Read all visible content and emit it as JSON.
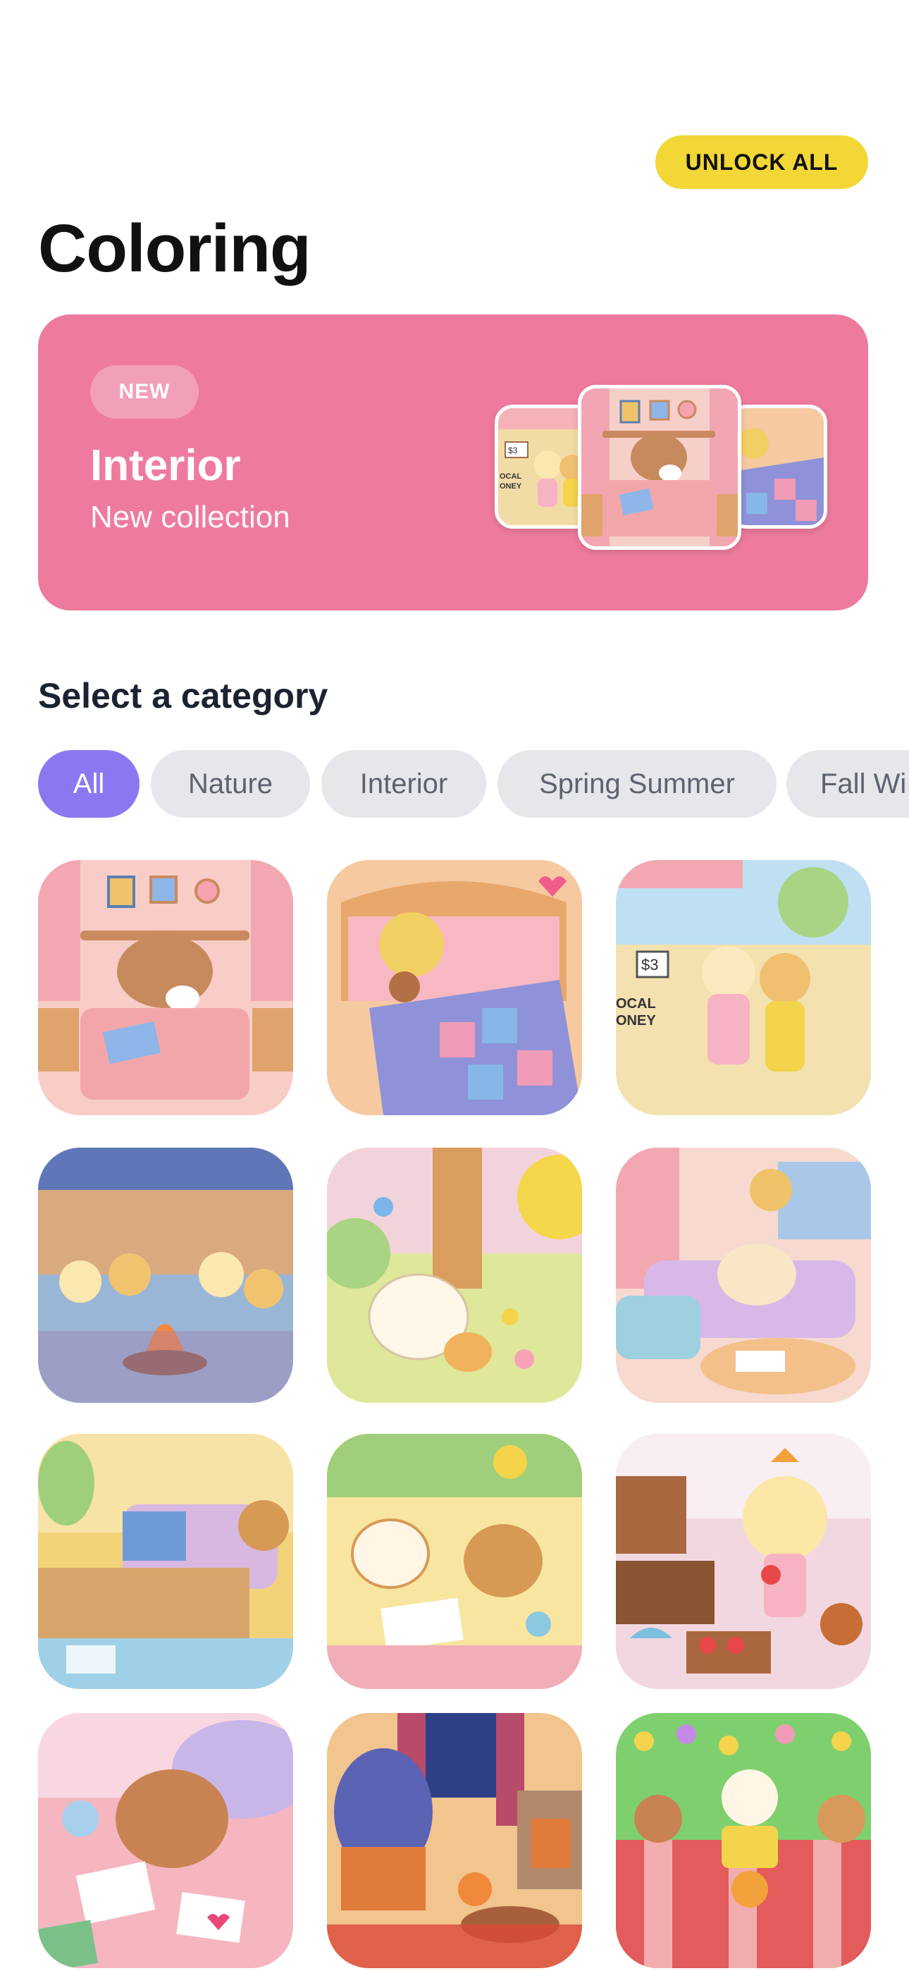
{
  "header": {
    "unlock_label": "UNLOCK ALL"
  },
  "page": {
    "title": "Coloring"
  },
  "banner": {
    "badge": "NEW",
    "title": "Interior",
    "subtitle": "New collection",
    "colors": {
      "background": "#ee7b9d"
    },
    "thumb_texts": {
      "price": "$3",
      "sign": "OCAL\nONEY"
    }
  },
  "categories": {
    "title": "Select a category",
    "items": [
      "All",
      "Nature",
      "Interior",
      "Spring Summer",
      "Fall Wi"
    ],
    "selected": "All",
    "colors": {
      "active": "#8b78f0",
      "inactive": "#e6e7ea"
    }
  },
  "gallery": {
    "items": [
      {
        "id": "sleeping-puppy-bedroom",
        "bg": "#f8cdc8",
        "accent": "#c08a5f"
      },
      {
        "id": "puppy-quilt-bed",
        "bg": "#f6c9a0",
        "accent": "#f2cf62"
      },
      {
        "id": "local-market",
        "bg": "#f3e1b0",
        "accent": "#f0cf8a",
        "sign_price": "$3",
        "sign_text": "OCAL\nONEY"
      },
      {
        "id": "campfire-night",
        "bg": "#9ab6d6",
        "accent": "#f2c36e"
      },
      {
        "id": "forest-puppy-kitten",
        "bg": "#dfe79a",
        "accent": "#fff7e8"
      },
      {
        "id": "cozy-nap-sofa",
        "bg": "#f7d9cf",
        "accent": "#d8b8e8"
      },
      {
        "id": "living-room-laptop",
        "bg": "#f3d37a",
        "accent": "#d7a56a"
      },
      {
        "id": "puppy-bear-drawing",
        "bg": "#f8e6a0",
        "accent": "#d79a55"
      },
      {
        "id": "garden-strawberries",
        "bg": "#f3d7e0",
        "accent": "#fbe7a6"
      },
      {
        "id": "puppy-writing-letters",
        "bg": "#f5b6c0",
        "accent": "#c98352"
      },
      {
        "id": "autumn-fireplace",
        "bg": "#f2c48e",
        "accent": "#e07a3a"
      },
      {
        "id": "picnic-meadow",
        "bg": "#7ed06e",
        "accent": "#e35b5b"
      }
    ]
  }
}
